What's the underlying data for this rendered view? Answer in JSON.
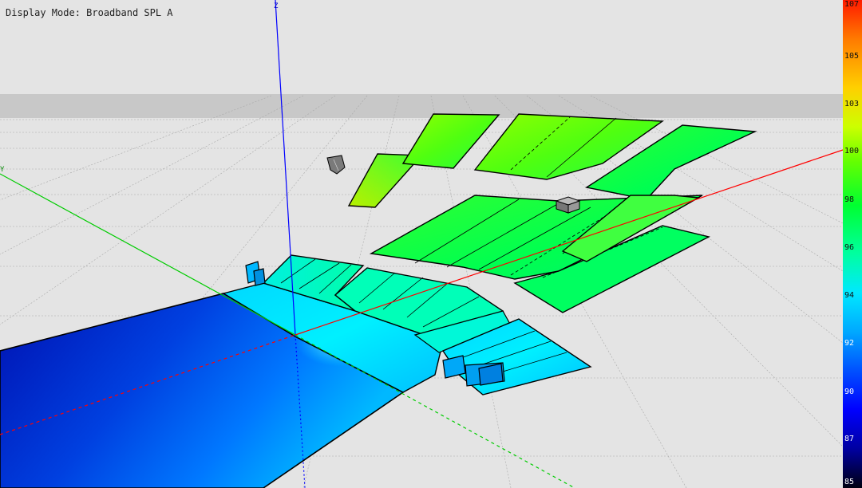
{
  "header": {
    "display_mode": "Display Mode: Broadband SPL A"
  },
  "axes": {
    "z_label": "Z",
    "y_label": "Y",
    "x_label": ""
  },
  "colorbar": {
    "ticks": [
      "107",
      "105",
      "103",
      "100",
      "98",
      "96",
      "94",
      "92",
      "90",
      "87",
      "85"
    ],
    "max": 107,
    "min": 85
  },
  "colors": {
    "axis_x": "#ff0000",
    "axis_y": "#00cc00",
    "axis_z": "#0000ff",
    "background": "#e4e4e4",
    "grid": "#9a9a9a"
  },
  "scene": {
    "surfaces": [
      "stage-floor",
      "front-stalls",
      "side-stalls",
      "rear-stalls",
      "balcony-left",
      "balcony-center",
      "balcony-right"
    ],
    "sources": [
      "speaker-left",
      "speaker-center",
      "speaker-right",
      "speaker-balcony",
      "speaker-rear"
    ]
  }
}
